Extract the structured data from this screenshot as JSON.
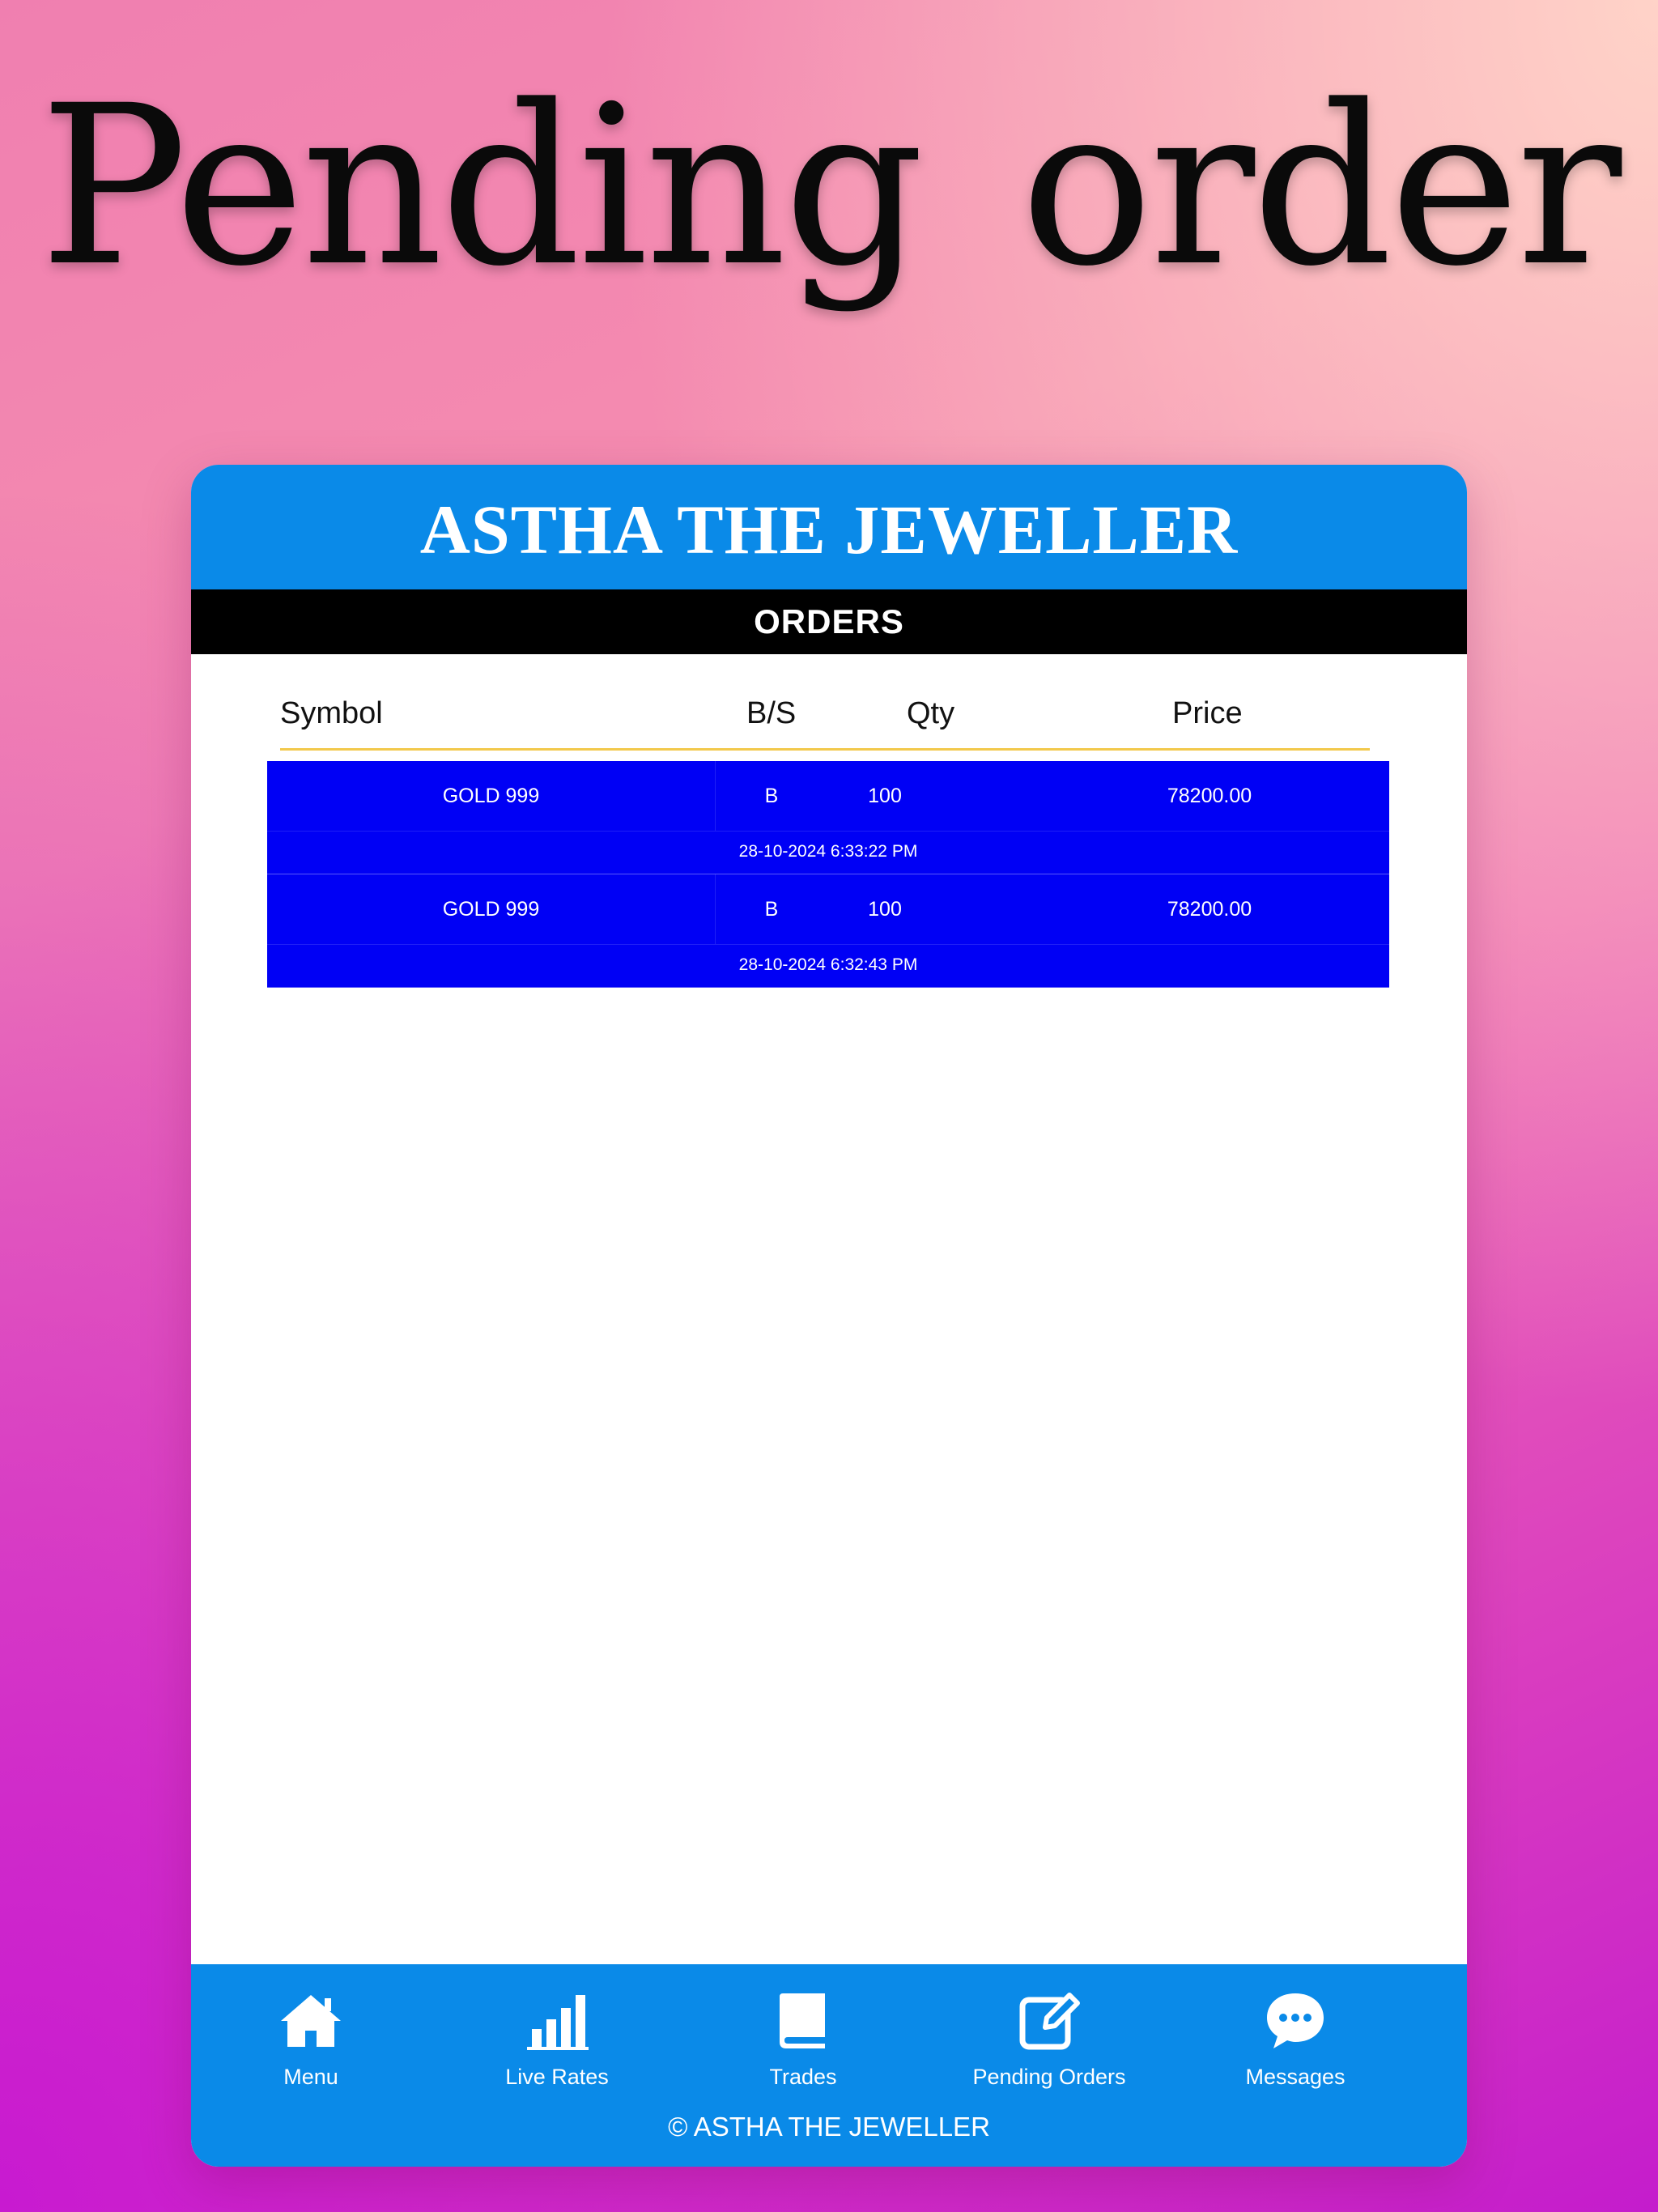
{
  "promo": {
    "title": "Pending  order"
  },
  "app": {
    "brand": "ASTHA THE JEWELLER",
    "section_title": "ORDERS"
  },
  "table": {
    "headers": {
      "symbol": "Symbol",
      "bs": "B/S",
      "qty": "Qty",
      "price": "Price"
    },
    "orders": [
      {
        "symbol": "GOLD 999",
        "bs": "B",
        "qty": "100",
        "price": "78200.00",
        "time": "28-10-2024 6:33:22 PM"
      },
      {
        "symbol": "GOLD 999",
        "bs": "B",
        "qty": "100",
        "price": "78200.00",
        "time": "28-10-2024 6:32:43 PM"
      }
    ]
  },
  "nav": {
    "items": [
      {
        "label": "Menu",
        "icon": "home-icon"
      },
      {
        "label": "Live Rates",
        "icon": "bar-chart-icon"
      },
      {
        "label": "Trades",
        "icon": "book-icon"
      },
      {
        "label": "Pending Orders",
        "icon": "edit-icon"
      },
      {
        "label": "Messages",
        "icon": "chat-icon"
      }
    ],
    "copyright": "© ASTHA THE JEWELLER"
  },
  "colors": {
    "brand_blue": "#0a8ae8",
    "order_row": "#0000f5",
    "header_underline": "#f2c94c"
  }
}
